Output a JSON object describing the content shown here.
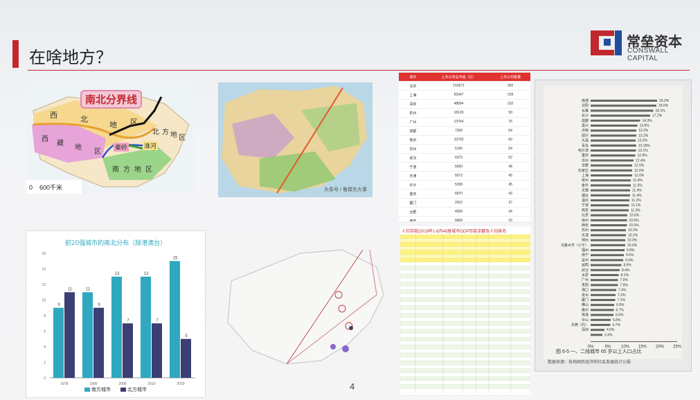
{
  "slide": {
    "title": "在啥地方？",
    "page_number": "4",
    "brand_color": "#c0282d"
  },
  "logo": {
    "name_cn": "常垒资本",
    "name_en": "CONSWALL CAPITAL",
    "icon": "conswall-logo-icon"
  },
  "map1": {
    "title": "南北分界线",
    "labels": [
      "西",
      "北",
      "地",
      "区",
      "西",
      "藏",
      "地",
      "区",
      "秦岭",
      "淮河",
      "南",
      "方",
      "地",
      "区",
      "北",
      "方",
      "地",
      "区"
    ],
    "scale": "0    600千米"
  },
  "map2": {
    "caption": "头条号 / 鲁霖东大事"
  },
  "table1": {
    "headers": [
      "城市",
      "上市公司总市值（亿）",
      "上市公司数量"
    ],
    "rows": [
      [
        "北京",
        "153571",
        "282"
      ],
      [
        "上海",
        "56347",
        "239"
      ],
      [
        "深圳",
        "48894",
        "232"
      ],
      [
        "杭州",
        "18129",
        "93"
      ],
      [
        "广州",
        "13764",
        "76"
      ],
      [
        "成都",
        "7393",
        "64"
      ],
      [
        "南京",
        "10703",
        "60"
      ],
      [
        "苏州",
        "5166",
        "54"
      ],
      [
        "武汉",
        "6373",
        "52"
      ],
      [
        "宁波",
        "5650",
        "48"
      ],
      [
        "天津",
        "5572",
        "45"
      ],
      [
        "长沙",
        "5358",
        "45"
      ],
      [
        "重庆",
        "6870",
        "43"
      ],
      [
        "厦门",
        "2922",
        "37"
      ],
      [
        "合肥",
        "4059",
        "34"
      ],
      [
        "西安",
        "5869",
        "33"
      ],
      [
        "乌鲁木齐",
        "4751",
        "31"
      ],
      [
        "福州",
        "6949",
        "31"
      ],
      [
        "郑州",
        "3916",
        "31"
      ],
      [
        "汕头",
        "2584",
        "27"
      ],
      [
        "台州",
        "2727",
        "27"
      ],
      [
        "无锡",
        "3891",
        "27"
      ]
    ]
  },
  "chart_data": {
    "type": "bar",
    "title": "前20强城市的南北分布（除港澳台）",
    "categories": [
      "1978",
      "1990",
      "2000",
      "2010",
      "2019"
    ],
    "series": [
      {
        "name": "南方城市",
        "values": [
          9,
          11,
          13,
          13,
          15
        ],
        "color": "#2fa8c0"
      },
      {
        "name": "北方城市",
        "values": [
          11,
          9,
          7,
          7,
          5
        ],
        "color": "#3b3f73"
      }
    ],
    "ylim": [
      0,
      16
    ],
    "yticks": [
      "0",
      "2",
      "4",
      "6",
      "8",
      "10",
      "12",
      "14",
      "16"
    ],
    "grid": false,
    "legend_position": "bottom"
  },
  "table2": {
    "title": "人均存款|2019年1-8月40座城市GDP存款余额及人均排名"
  },
  "photo": {
    "title": "图 6-5  一、二线城市 65 岁以上人口占比",
    "source": "数据来源：各地国民经济和社会发展统计公报",
    "x_ticks": [
      "0%",
      "5%",
      "10%",
      "15%",
      "20%",
      "25%"
    ],
    "rows": [
      [
        "南通",
        "19.2%"
      ],
      [
        "沈阳",
        "19.0%"
      ],
      [
        "长春",
        "18.1%"
      ],
      [
        "长沙",
        "17.2%"
      ],
      [
        "成都",
        "14.3%"
      ],
      [
        "嘉兴",
        "13.5%"
      ],
      [
        "济南",
        "13.2%"
      ],
      [
        "绍兴",
        "13.2%"
      ],
      [
        "大连",
        "13.0%"
      ],
      [
        "青岛",
        "13.15%"
      ],
      [
        "哈尔滨",
        "13.1%"
      ],
      [
        "重庆",
        "12.9%"
      ],
      [
        "台州",
        "12.4%"
      ],
      [
        "合肥",
        "12.0%"
      ],
      [
        "石家庄",
        "12.0%"
      ],
      [
        "上海",
        "12.0%"
      ],
      [
        "常州",
        "11.6%"
      ],
      [
        "金华",
        "11.6%"
      ],
      [
        "无锡",
        "11.4%"
      ],
      [
        "烟台",
        "11.4%"
      ],
      [
        "温州",
        "11.2%"
      ],
      [
        "宁波",
        "11.1%"
      ],
      [
        "南京",
        "11.0%"
      ],
      [
        "北京",
        "10.6%"
      ],
      [
        "徐州",
        "10.5%"
      ],
      [
        "西安",
        "10.5%"
      ],
      [
        "苏州",
        "10.2%"
      ],
      [
        "天津",
        "10.2%"
      ],
      [
        "郑州",
        "10.0%"
      ],
      [
        "乌鲁木齐（小于）",
        "10.0%"
      ],
      [
        "福州",
        "9.8%"
      ],
      [
        "南宁",
        "9.6%"
      ],
      [
        "泉州",
        "9.4%"
      ],
      [
        "昆明",
        "8.9%"
      ],
      [
        "武汉",
        "8.4%"
      ],
      [
        "太原",
        "8.1%"
      ],
      [
        "广州",
        "7.9%"
      ],
      [
        "贵阳",
        "7.9%"
      ],
      [
        "海口",
        "7.4%"
      ],
      [
        "泉州",
        "7.2%"
      ],
      [
        "厦门",
        "7.1%"
      ],
      [
        "佛山",
        "6.8%"
      ],
      [
        "惠州",
        "6.7%"
      ],
      [
        "珠海",
        "6.6%"
      ],
      [
        "中山",
        "5.8%"
      ],
      [
        "东莞（约）",
        "5.7%"
      ],
      [
        "深圳",
        "4.0%"
      ],
      [
        "",
        "3.4%"
      ]
    ]
  }
}
